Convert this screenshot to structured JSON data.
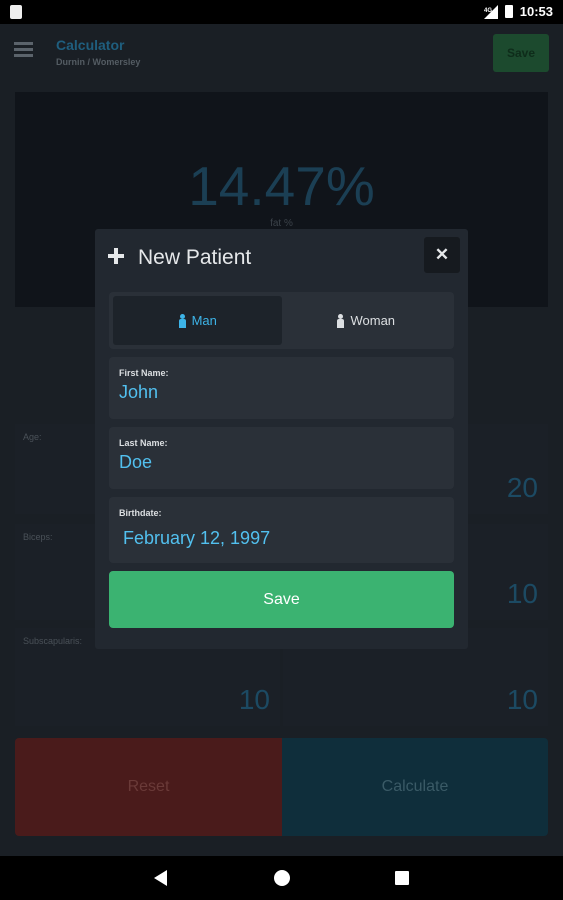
{
  "status_bar": {
    "time": "10:53",
    "network": "4G"
  },
  "app_bar": {
    "title": "Calculator",
    "subtitle": "Durnin / Womersley",
    "save_label": "Save"
  },
  "result": {
    "value": "14.47%",
    "label": "fat %"
  },
  "measurements": {
    "age_label": "Age:",
    "age_value": "20",
    "biceps_label": "Biceps:",
    "biceps_value": "10",
    "subscapularis_label": "Subscapularis:",
    "subscapularis_value": "10",
    "right_mid_value": "10",
    "right_bottom_value": "10"
  },
  "actions": {
    "reset_label": "Reset",
    "calculate_label": "Calculate"
  },
  "modal": {
    "title": "New Patient",
    "close_symbol": "✕",
    "gender": {
      "options": [
        "Man",
        "Woman"
      ],
      "selected": "Man"
    },
    "first_name_label": "First Name:",
    "first_name_value": "John",
    "last_name_label": "Last Name:",
    "last_name_value": "Doe",
    "birthdate_label": "Birthdate:",
    "birthdate_value": "February 12, 1997",
    "save_label": "Save"
  },
  "colors": {
    "accent_blue": "#52c0ef",
    "save_green": "#3bb371",
    "reset_red": "#4a1b1b",
    "calculate_teal": "#0f2e3b"
  }
}
